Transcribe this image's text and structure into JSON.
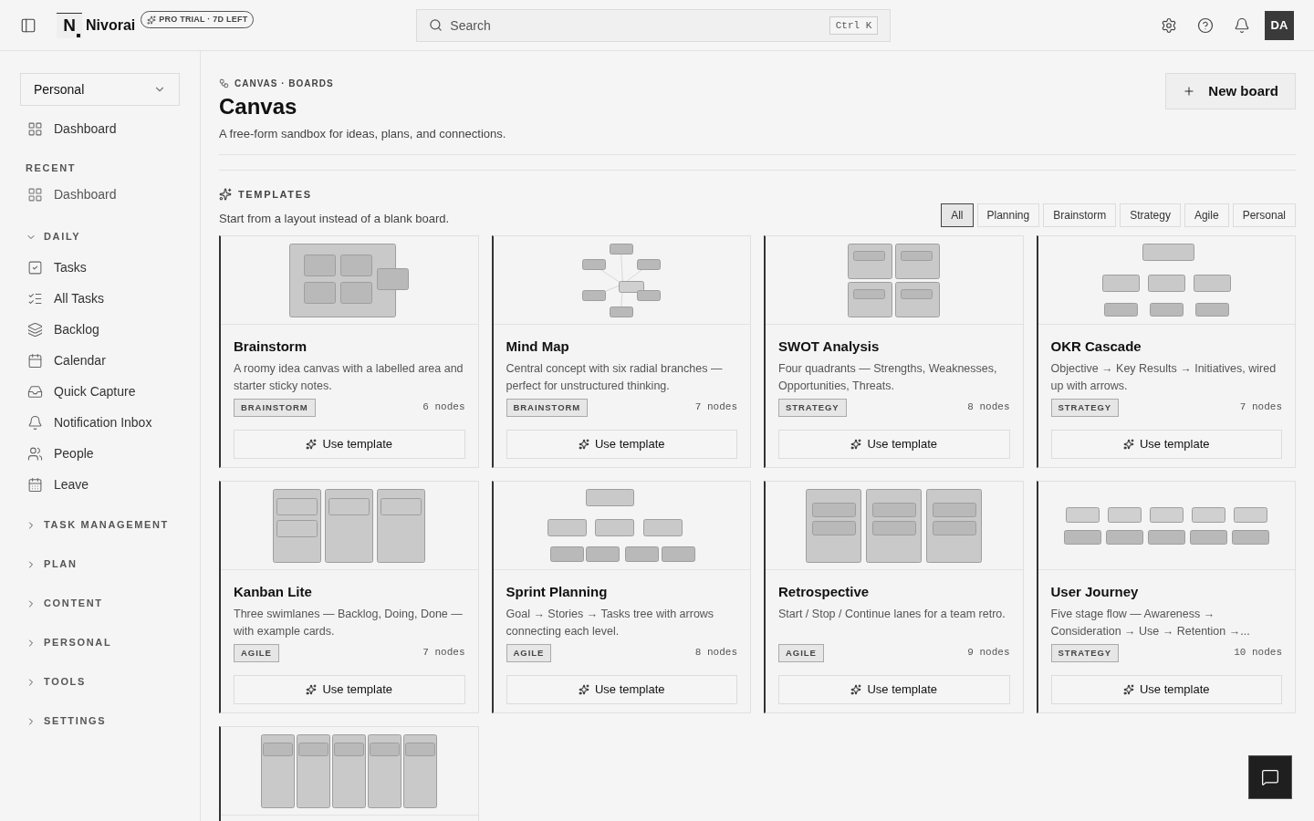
{
  "header": {
    "logo_letter": "N",
    "brand": "Nivorai",
    "trial_badge": "PRO TRIAL · 7D LEFT",
    "search": {
      "placeholder": "Search",
      "shortcut": "Ctrl K"
    },
    "avatar": "DA"
  },
  "sidebar": {
    "workspace": "Personal",
    "top_items": [
      {
        "label": "Dashboard"
      }
    ],
    "recent": {
      "title": "RECENT",
      "items": [
        {
          "label": "Dashboard"
        }
      ]
    },
    "groups": [
      {
        "title": "DAILY",
        "expanded": true,
        "items": [
          {
            "label": "Tasks"
          },
          {
            "label": "All Tasks"
          },
          {
            "label": "Backlog"
          },
          {
            "label": "Calendar"
          },
          {
            "label": "Quick Capture"
          },
          {
            "label": "Notification Inbox"
          },
          {
            "label": "People"
          },
          {
            "label": "Leave"
          }
        ]
      },
      {
        "title": "TASK MANAGEMENT",
        "expanded": false
      },
      {
        "title": "PLAN",
        "expanded": false
      },
      {
        "title": "CONTENT",
        "expanded": false
      },
      {
        "title": "PERSONAL",
        "expanded": false
      },
      {
        "title": "TOOLS",
        "expanded": false
      },
      {
        "title": "SETTINGS",
        "expanded": false
      }
    ]
  },
  "page": {
    "breadcrumb": "CANVAS · BOARDS",
    "title": "Canvas",
    "subtitle": "A free-form sandbox for ideas, plans, and connections.",
    "new_button": "New board"
  },
  "templates": {
    "title": "TEMPLATES",
    "subtitle": "Start from a layout instead of a blank board.",
    "filters": [
      {
        "label": "All",
        "selected": true
      },
      {
        "label": "Planning",
        "selected": false
      },
      {
        "label": "Brainstorm",
        "selected": false
      },
      {
        "label": "Strategy",
        "selected": false
      },
      {
        "label": "Agile",
        "selected": false
      },
      {
        "label": "Personal",
        "selected": false
      }
    ],
    "cards": [
      {
        "kind": "brainstorm",
        "title": "Brainstorm",
        "description": "A roomy idea canvas with a labelled area and starter sticky notes.",
        "tag": "BRAINSTORM",
        "nodes": "6 nodes",
        "action": "Use template"
      },
      {
        "kind": "mindmap",
        "title": "Mind Map",
        "description": "Central concept with six radial branches — perfect for unstructured thinking.",
        "tag": "BRAINSTORM",
        "nodes": "7 nodes",
        "action": "Use template"
      },
      {
        "kind": "swot",
        "title": "SWOT Analysis",
        "description": "Four quadrants — Strengths, Weaknesses, Opportunities, Threats.",
        "tag": "STRATEGY",
        "nodes": "8 nodes",
        "action": "Use template"
      },
      {
        "kind": "okr",
        "title": "OKR Cascade",
        "description": "Objective → Key Results → Initiatives, wired up with arrows.",
        "tag": "STRATEGY",
        "nodes": "7 nodes",
        "action": "Use template"
      },
      {
        "kind": "kanban",
        "title": "Kanban Lite",
        "description": "Three swimlanes — Backlog, Doing, Done — with example cards.",
        "tag": "AGILE",
        "nodes": "7 nodes",
        "action": "Use template"
      },
      {
        "kind": "sprint",
        "title": "Sprint Planning",
        "description": "Goal → Stories → Tasks tree with arrows connecting each level.",
        "tag": "AGILE",
        "nodes": "8 nodes",
        "action": "Use template"
      },
      {
        "kind": "retro",
        "title": "Retrospective",
        "description": "Start / Stop / Continue lanes for a team retro.",
        "tag": "AGILE",
        "nodes": "9 nodes",
        "action": "Use template"
      },
      {
        "kind": "journey",
        "title": "User Journey",
        "description": "Five stage flow — Awareness → Consideration → Use → Retention →...",
        "tag": "STRATEGY",
        "nodes": "10 nodes",
        "action": "Use template"
      },
      {
        "kind": "columns"
      }
    ]
  }
}
